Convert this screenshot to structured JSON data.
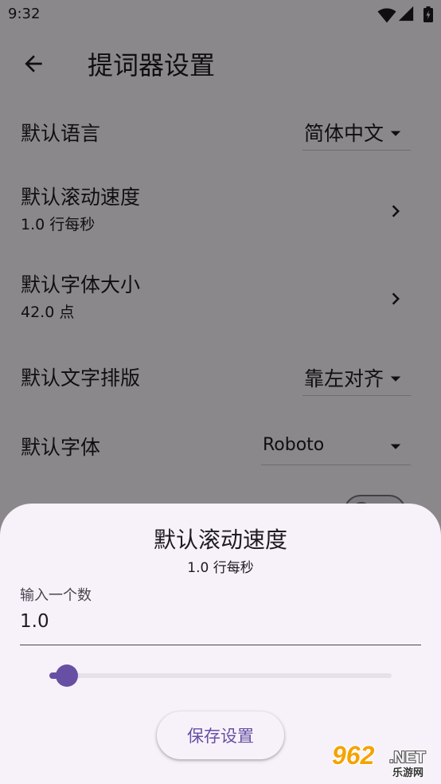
{
  "status_bar": {
    "time": "9:32",
    "icons": [
      "wifi-icon",
      "cell-signal-icon",
      "battery-charging-icon"
    ]
  },
  "app_bar": {
    "back_icon": "arrow-back-icon",
    "title": "提词器设置"
  },
  "settings": {
    "language": {
      "label": "默认语言",
      "value": "简体中文",
      "icon": "arrow-drop-down-icon"
    },
    "scroll_speed": {
      "label": "默认滚动速度",
      "subtitle": "1.0 行每秒",
      "icon": "chevron-right-icon"
    },
    "font_size": {
      "label": "默认字体大小",
      "subtitle": "42.0 点",
      "icon": "chevron-right-icon"
    },
    "alignment": {
      "label": "默认文字排版",
      "value": "靠左对齐",
      "icon": "arrow-drop-down-icon"
    },
    "font": {
      "label": "默认字体",
      "value": "Roboto",
      "icon": "arrow-drop-down-icon"
    },
    "switch": {
      "checked": false
    }
  },
  "dialog": {
    "title": "默认滚动速度",
    "subtitle": "1.0 行每秒",
    "input": {
      "label": "输入一个数",
      "value": "1.0"
    },
    "slider": {
      "fraction": 0.05
    },
    "save_button": "保存设置"
  },
  "watermark": {
    "brand": "962",
    "suffix": ".NET",
    "name": "乐游网"
  },
  "colors": {
    "primary": "#6750A4",
    "sheet_background": "#F7F2FA",
    "surface": "#FEF7FF",
    "scrim": "#00000073"
  }
}
